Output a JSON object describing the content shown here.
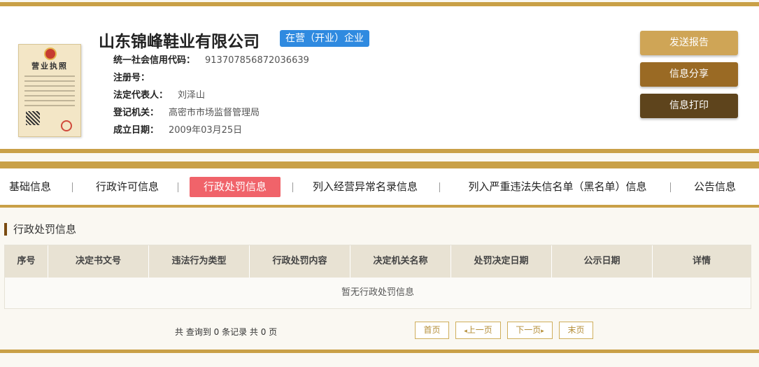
{
  "company": {
    "name": "山东锦峰鞋业有限公司",
    "status": "在营（开业）企业",
    "license_image": {
      "title": "营业执照"
    }
  },
  "fields": [
    {
      "label": "统一社会信用代码：",
      "value": "913707856872036639"
    },
    {
      "label": "注册号：",
      "value": ""
    },
    {
      "label": "法定代表人：",
      "value": "刘泽山"
    },
    {
      "label": "登记机关：",
      "value": "高密市市场监督管理局"
    },
    {
      "label": "成立日期：",
      "value": "2009年03月25日"
    }
  ],
  "actions": {
    "send_report": "发送报告",
    "share": "信息分享",
    "print": "信息打印"
  },
  "tabs": [
    {
      "label": "基础信息",
      "active": false
    },
    {
      "label": "行政许可信息",
      "active": false
    },
    {
      "label": "行政处罚信息",
      "active": true
    },
    {
      "label": "列入经营异常名录信息",
      "active": false
    },
    {
      "label": "列入严重违法失信名单（黑名单）信息",
      "active": false
    },
    {
      "label": "公告信息",
      "active": false
    }
  ],
  "section": {
    "title": "行政处罚信息",
    "columns": [
      "序号",
      "决定书文号",
      "违法行为类型",
      "行政处罚内容",
      "决定机关名称",
      "处罚决定日期",
      "公示日期",
      "详情"
    ],
    "empty_text": "暂无行政处罚信息"
  },
  "pager": {
    "summary": "共 查询到 0 条记录 共 0 页",
    "first": "首页",
    "prev": "上一页",
    "next": "下一页",
    "last": "末页"
  },
  "colors": {
    "gold": "#c9a047",
    "btn_send": "#cfa556",
    "btn_share": "#9a6a24",
    "btn_print": "#5e441c",
    "badge": "#2f8ae0",
    "active_tab": "#f0636a"
  }
}
